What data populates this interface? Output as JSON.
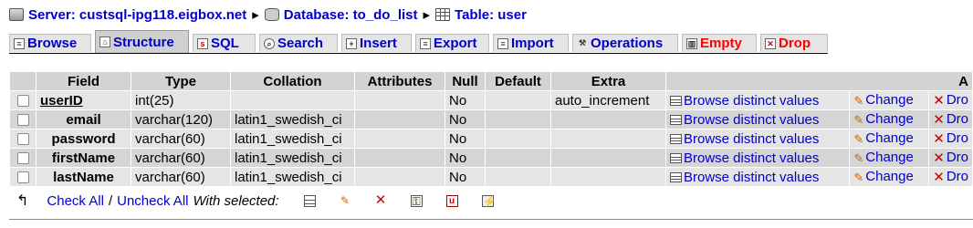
{
  "breadcrumb": {
    "server": "Server: custsql-ipg118.eigbox.net",
    "database": "Database: to_do_list",
    "table": "Table: user",
    "separator": "▸"
  },
  "tabs": [
    {
      "label": "Browse",
      "icon": "browse-icon",
      "active": false
    },
    {
      "label": "Structure",
      "icon": "structure-icon",
      "active": true
    },
    {
      "label": "SQL",
      "icon": "sql-icon",
      "active": false
    },
    {
      "label": "Search",
      "icon": "search-icon",
      "active": false
    },
    {
      "label": "Insert",
      "icon": "insert-icon",
      "active": false
    },
    {
      "label": "Export",
      "icon": "export-icon",
      "active": false
    },
    {
      "label": "Import",
      "icon": "import-icon",
      "active": false
    },
    {
      "label": "Operations",
      "icon": "operations-icon",
      "active": false
    },
    {
      "label": "Empty",
      "icon": "empty-icon",
      "active": false
    },
    {
      "label": "Drop",
      "icon": "drop-icon",
      "active": false
    }
  ],
  "table": {
    "headers": [
      "Field",
      "Type",
      "Collation",
      "Attributes",
      "Null",
      "Default",
      "Extra",
      "A"
    ],
    "rows": [
      {
        "field": "userID",
        "type": "int(25)",
        "collation": "",
        "attributes": "",
        "null": "No",
        "default": "",
        "extra": "auto_increment",
        "primary": true
      },
      {
        "field": "email",
        "type": "varchar(120)",
        "collation": "latin1_swedish_ci",
        "attributes": "",
        "null": "No",
        "default": "",
        "extra": "",
        "primary": false
      },
      {
        "field": "password",
        "type": "varchar(60)",
        "collation": "latin1_swedish_ci",
        "attributes": "",
        "null": "No",
        "default": "",
        "extra": "",
        "primary": false
      },
      {
        "field": "firstName",
        "type": "varchar(60)",
        "collation": "latin1_swedish_ci",
        "attributes": "",
        "null": "No",
        "default": "",
        "extra": "",
        "primary": false
      },
      {
        "field": "lastName",
        "type": "varchar(60)",
        "collation": "latin1_swedish_ci",
        "attributes": "",
        "null": "No",
        "default": "",
        "extra": "",
        "primary": false
      }
    ],
    "actions": {
      "browse": "Browse distinct values",
      "change": "Change",
      "drop": "Dro"
    }
  },
  "footer": {
    "check_all": "Check All",
    "slash": "/",
    "uncheck_all": "Uncheck All",
    "with_selected": "With selected:"
  },
  "colors": {
    "link": "#0000cc",
    "danger": "#ff0000",
    "header_bg": "#d3d3d3",
    "row_odd": "#e5e5e5",
    "row_even": "#d5d5d5"
  }
}
